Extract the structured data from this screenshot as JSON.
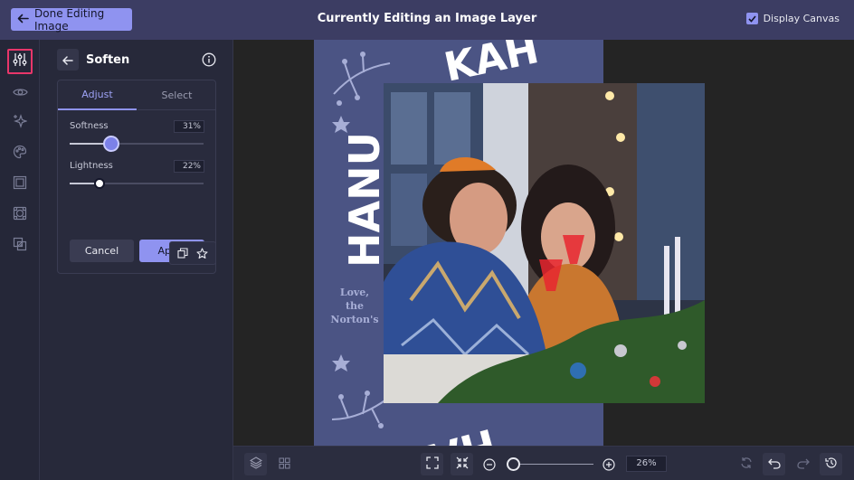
{
  "header": {
    "done_label": "Done Editing Image",
    "title": "Currently Editing an Image Layer",
    "display_canvas_label": "Display Canvas",
    "display_canvas_checked": true
  },
  "rail": {
    "items": [
      "adjustments-icon",
      "eye-icon",
      "sparkle-icon",
      "palette-icon",
      "frame-icon",
      "crop-icon",
      "layers-icon"
    ],
    "active": "adjustments-icon"
  },
  "panel": {
    "title": "Soften",
    "tabs": [
      {
        "label": "Adjust",
        "active": true
      },
      {
        "label": "Select",
        "active": false
      }
    ],
    "softness": {
      "label": "Softness",
      "value_text": "31%",
      "value": 31
    },
    "lightness": {
      "label": "Lightness",
      "value_text": "22%",
      "value": 22
    },
    "cancel_label": "Cancel",
    "apply_label": "Apply"
  },
  "canvas": {
    "headline": "HANUKKAH",
    "signoff": [
      "Love,",
      "the",
      "Norton's"
    ]
  },
  "bottombar": {
    "zoom_text": "26%",
    "zoom_value": 0.26
  },
  "colors": {
    "accent": "#8f93f0",
    "topbar": "#3c3d63",
    "card_bg": "#4b5484",
    "active_outline": "#e8366a"
  }
}
